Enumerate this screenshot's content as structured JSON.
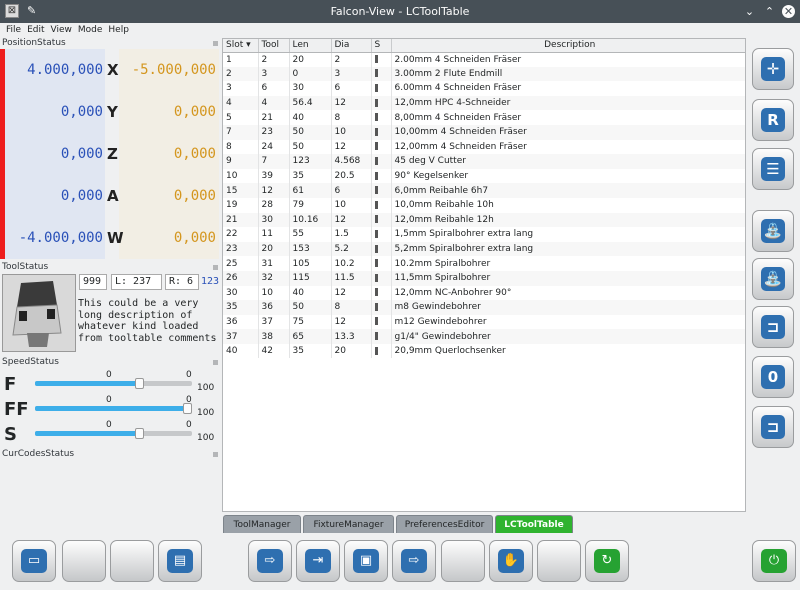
{
  "window": {
    "title": "Falcon-View - LCToolTable"
  },
  "menu": [
    "File",
    "Edit",
    "View",
    "Mode",
    "Help"
  ],
  "position": {
    "section_title": "PositionStatus",
    "rows": [
      {
        "mach": "4.000,000",
        "axis": "X",
        "rel": "-5.000,000"
      },
      {
        "mach": "0,000",
        "axis": "Y",
        "rel": "0,000"
      },
      {
        "mach": "0,000",
        "axis": "Z",
        "rel": "0,000"
      },
      {
        "mach": "0,000",
        "axis": "A",
        "rel": "0,000"
      },
      {
        "mach": "-4.000,000",
        "axis": "W",
        "rel": "0,000"
      }
    ]
  },
  "tool": {
    "section_title": "ToolStatus",
    "number": "999",
    "length": "L: 237",
    "radius": "R: 6",
    "extra": "123",
    "description": "This could be a very long description of whatever kind loaded from tooltable comments"
  },
  "speed": {
    "section_title": "SpeedStatus",
    "rows": [
      {
        "label": "F",
        "left": "0",
        "right": "0",
        "max": "100",
        "fraction": 0.66
      },
      {
        "label": "FF",
        "left": "0",
        "right": "0",
        "max": "100",
        "fraction": 0.97
      },
      {
        "label": "S",
        "left": "0",
        "right": "0",
        "max": "100",
        "fraction": 0.66
      }
    ]
  },
  "curcodes": {
    "section_title": "CurCodesStatus"
  },
  "tooltable": {
    "columns": [
      "Slot",
      "Tool",
      "Len",
      "Dia",
      "S",
      "Description"
    ],
    "sort_indicator": "▾",
    "rows": [
      [
        "1",
        "2",
        "20",
        "2",
        "2.00mm 4 Schneiden Fräser"
      ],
      [
        "2",
        "3",
        "0",
        "3",
        "3.00mm 2 Flute Endmill"
      ],
      [
        "3",
        "6",
        "30",
        "6",
        "6.00mm 4 Schneiden Fräser"
      ],
      [
        "4",
        "4",
        "56.4",
        "12",
        "12,0mm HPC 4-Schneider"
      ],
      [
        "5",
        "21",
        "40",
        "8",
        "8,00mm 4 Schneiden Fräser"
      ],
      [
        "7",
        "23",
        "50",
        "10",
        "10,00mm 4 Schneiden Fräser"
      ],
      [
        "8",
        "24",
        "50",
        "12",
        "12,00mm 4 Schneiden Fräser"
      ],
      [
        "9",
        "7",
        "123",
        "4.568",
        "45 deg V Cutter"
      ],
      [
        "10",
        "39",
        "35",
        "20.5",
        "90° Kegelsenker"
      ],
      [
        "15",
        "12",
        "61",
        "6",
        "6,0mm Reibahle 6h7"
      ],
      [
        "19",
        "28",
        "79",
        "10",
        "10,0mm Reibahle 10h"
      ],
      [
        "21",
        "30",
        "10.16",
        "12",
        "12,0mm Reibahle 12h"
      ],
      [
        "22",
        "11",
        "55",
        "1.5",
        "1,5mm Spiralbohrer extra lang"
      ],
      [
        "23",
        "20",
        "153",
        "5.2",
        "5,2mm Spiralbohrer extra lang"
      ],
      [
        "25",
        "31",
        "105",
        "10.2",
        "10.2mm Spiralbohrer"
      ],
      [
        "26",
        "32",
        "115",
        "11.5",
        "11,5mm Spiralbohrer"
      ],
      [
        "30",
        "10",
        "40",
        "12",
        "12,0mm NC-Anbohrer 90°"
      ],
      [
        "35",
        "36",
        "50",
        "8",
        "m8 Gewindebohrer"
      ],
      [
        "36",
        "37",
        "75",
        "12",
        "m12 Gewindebohrer"
      ],
      [
        "37",
        "38",
        "65",
        "13.3",
        "g1/4\" Gewindebohrer"
      ],
      [
        "40",
        "42",
        "35",
        "20",
        "20,9mm Querlochsenker"
      ]
    ]
  },
  "tabs": [
    {
      "label": "ToolManager"
    },
    {
      "label": "FixtureManager"
    },
    {
      "label": "PreferencesEditor"
    },
    {
      "label": "LCToolTable",
      "active": true
    }
  ],
  "right_buttons": [
    {
      "icon": "jog-pendant-icon",
      "glyph": "✛"
    },
    {
      "icon": "reference-r-icon",
      "glyph": "R"
    },
    {
      "icon": "list-view-icon",
      "glyph": "☰"
    },
    {
      "icon": "coolant-flood-icon",
      "glyph": "⛲"
    },
    {
      "icon": "coolant-mist-icon",
      "glyph": "⛲"
    },
    {
      "icon": "tool-change-icon",
      "glyph": "⊐"
    },
    {
      "icon": "tool-zero-icon",
      "glyph": "0"
    },
    {
      "icon": "tool-measure-icon",
      "glyph": "⊐"
    }
  ],
  "bottom_buttons": [
    {
      "icon": "info-screen-icon",
      "glyph": "▭"
    },
    {
      "icon": "blank-icon",
      "glyph": ""
    },
    {
      "icon": "blank-icon",
      "glyph": ""
    },
    {
      "icon": "program-file-icon",
      "glyph": "▤"
    },
    {
      "icon": "program-start-icon",
      "glyph": "⇨"
    },
    {
      "icon": "program-step-icon",
      "glyph": "⇥"
    },
    {
      "icon": "program-pause-icon",
      "glyph": "▣"
    },
    {
      "icon": "program-run-from-line-icon",
      "glyph": "⇨"
    },
    {
      "icon": "blank-icon",
      "glyph": ""
    },
    {
      "icon": "hand-stop-icon",
      "glyph": "✋"
    },
    {
      "icon": "blank-icon",
      "glyph": ""
    },
    {
      "icon": "document-reload-icon",
      "glyph": "↻",
      "green": true
    },
    {
      "icon": "power-icon",
      "glyph": "⏻",
      "green": true
    }
  ]
}
